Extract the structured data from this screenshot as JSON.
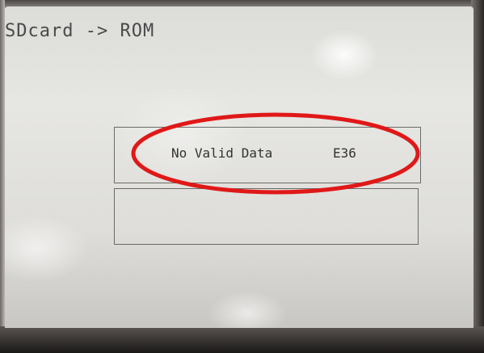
{
  "screen": {
    "title": "SDcard -> ROM"
  },
  "dialog": {
    "message": "No Valid Data",
    "error_code": "E36",
    "secondary_box_text": ""
  },
  "colors": {
    "annotation_ring": "#e01818",
    "text": "#333333",
    "screen_background": "#e2e2de"
  },
  "icons": []
}
